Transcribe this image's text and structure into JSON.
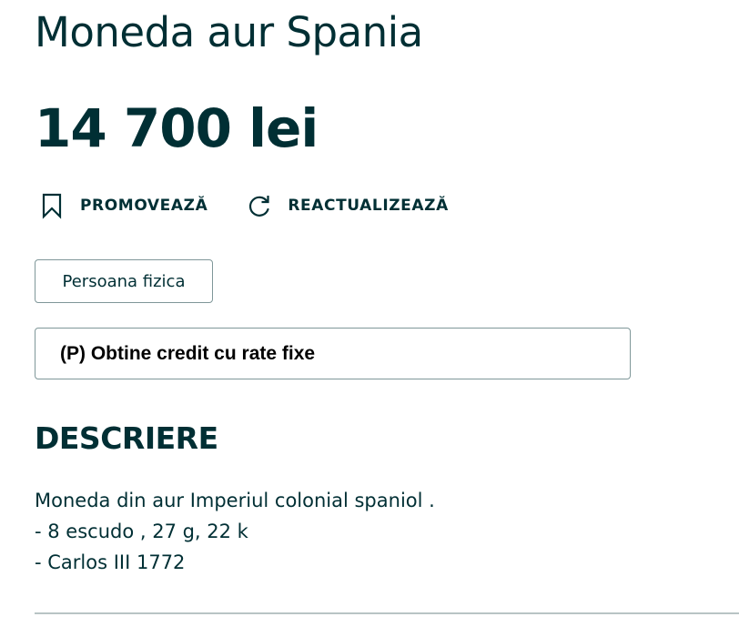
{
  "listing": {
    "title": "Moneda aur Spania",
    "price": "14 700 lei"
  },
  "actions": {
    "promote_label": "PROMOVEAZĂ",
    "promote_icon": "bookmark-icon",
    "refresh_label": "REACTUALIZEAZĂ",
    "refresh_icon": "refresh-icon"
  },
  "seller_type": "Persoana fizica",
  "credit_banner": "(P) Obtine credit cu rate fixe",
  "description": {
    "heading": "DESCRIERE",
    "lines": [
      "Moneda din aur Imperiul colonial spaniol .",
      "- 8 escudo , 27 g, 22 k",
      "- Carlos III 1772"
    ]
  },
  "colors": {
    "text": "#002f34",
    "border": "#7f9799",
    "divider": "#b8c4c5"
  }
}
